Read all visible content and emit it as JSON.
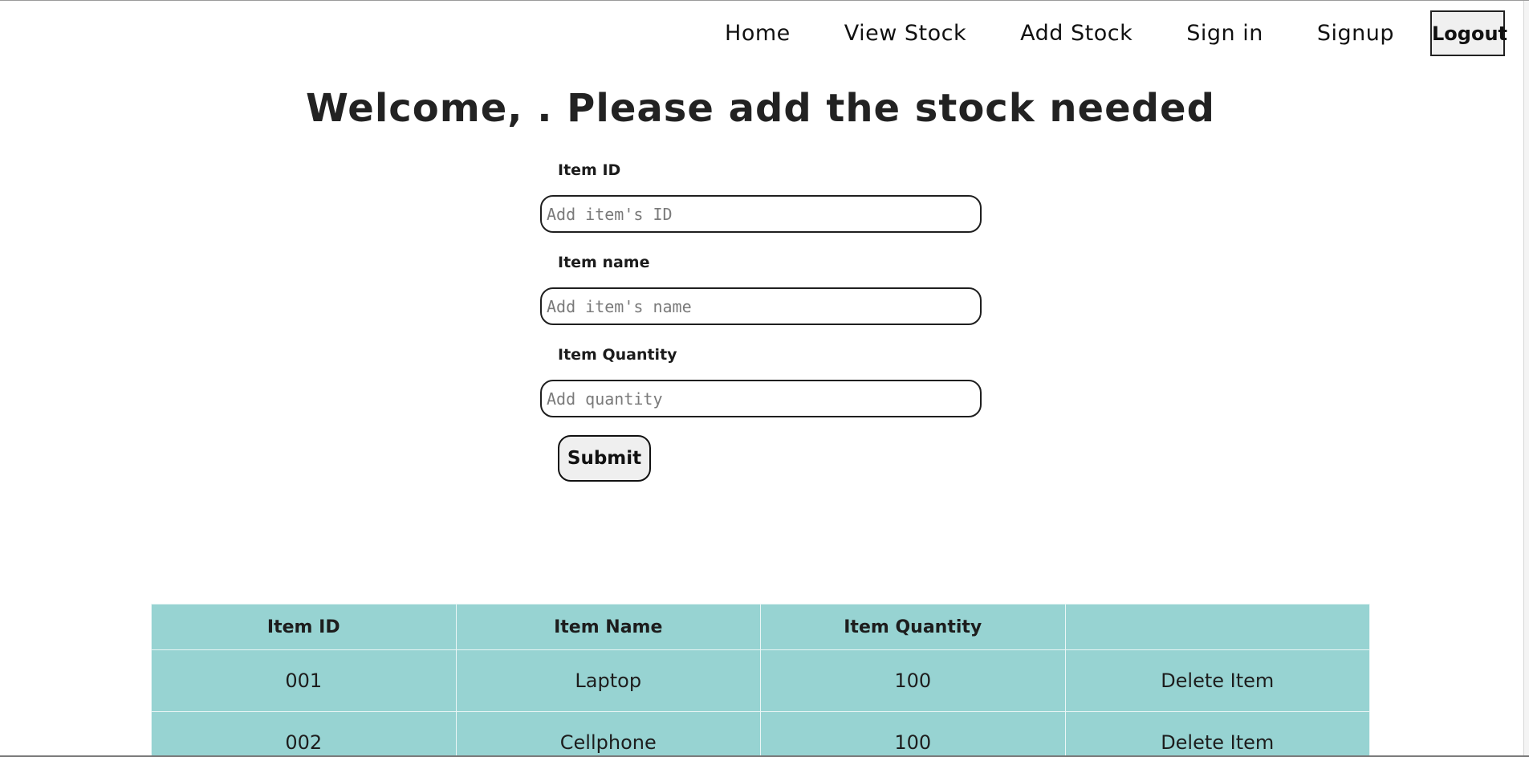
{
  "nav": {
    "items": [
      {
        "label": "Home"
      },
      {
        "label": "View Stock"
      },
      {
        "label": "Add Stock"
      },
      {
        "label": "Sign in"
      },
      {
        "label": "Signup"
      }
    ],
    "logout_label": "Logout"
  },
  "heading": "Welcome, . Please add the stock needed",
  "form": {
    "item_id": {
      "label": "Item ID",
      "placeholder": "Add item's ID",
      "value": ""
    },
    "item_name": {
      "label": "Item name",
      "placeholder": "Add item's name",
      "value": ""
    },
    "item_quantity": {
      "label": "Item Quantity",
      "placeholder": "Add quantity",
      "value": ""
    },
    "submit_label": "Submit"
  },
  "table": {
    "headers": [
      "Item ID",
      "Item Name",
      "Item Quantity",
      ""
    ],
    "rows": [
      {
        "id": "001",
        "name": "Laptop",
        "quantity": "100",
        "action": "Delete Item"
      },
      {
        "id": "002",
        "name": "Cellphone",
        "quantity": "100",
        "action": "Delete Item"
      }
    ]
  },
  "colors": {
    "table_bg": "#97d3d2",
    "text": "#1c1c1c",
    "button_bg": "#efefef"
  }
}
